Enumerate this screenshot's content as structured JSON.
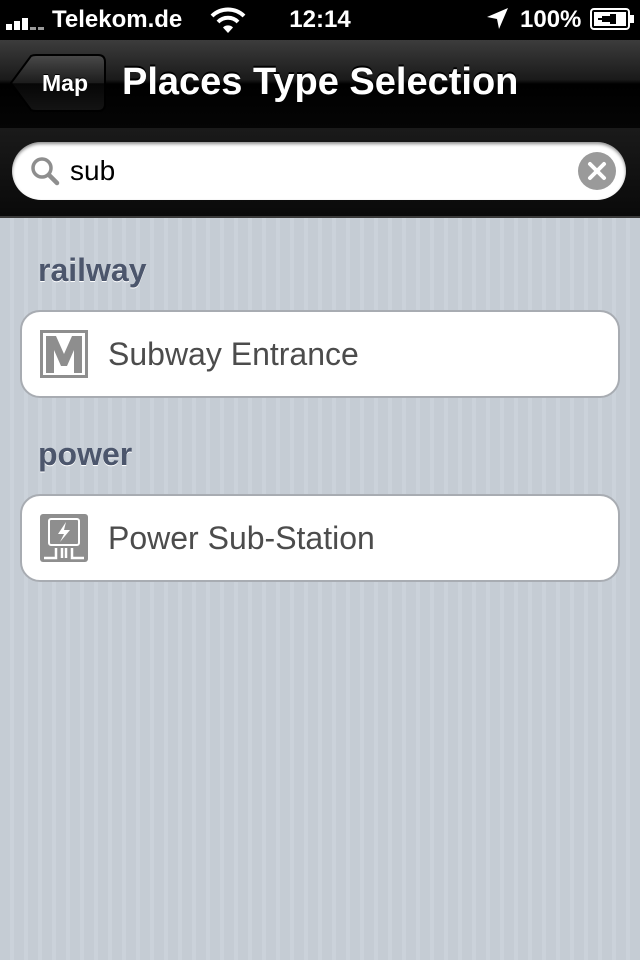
{
  "status_bar": {
    "carrier": "Telekom.de",
    "time": "12:14",
    "battery_percent": "100%",
    "signal_bars_active": 3,
    "signal_bars_total": 5,
    "icons": [
      "signal-icon",
      "wifi-icon",
      "location-arrow-icon",
      "battery-charging-icon"
    ]
  },
  "nav_bar": {
    "back_label": "Map",
    "title": "Places Type Selection"
  },
  "search": {
    "value": "sub",
    "icons": [
      "search-icon",
      "clear-icon"
    ]
  },
  "sections": [
    {
      "header": "railway",
      "items": [
        {
          "label": "Subway Entrance",
          "icon": "subway-icon"
        }
      ]
    },
    {
      "header": "power",
      "items": [
        {
          "label": "Power Sub-Station",
          "icon": "power-substation-icon"
        }
      ]
    }
  ],
  "colors": {
    "background": "#c5ccd4",
    "section_header": "#4c566c",
    "row_text": "#4c4c4c",
    "icon_gray": "#8e8e8e"
  }
}
